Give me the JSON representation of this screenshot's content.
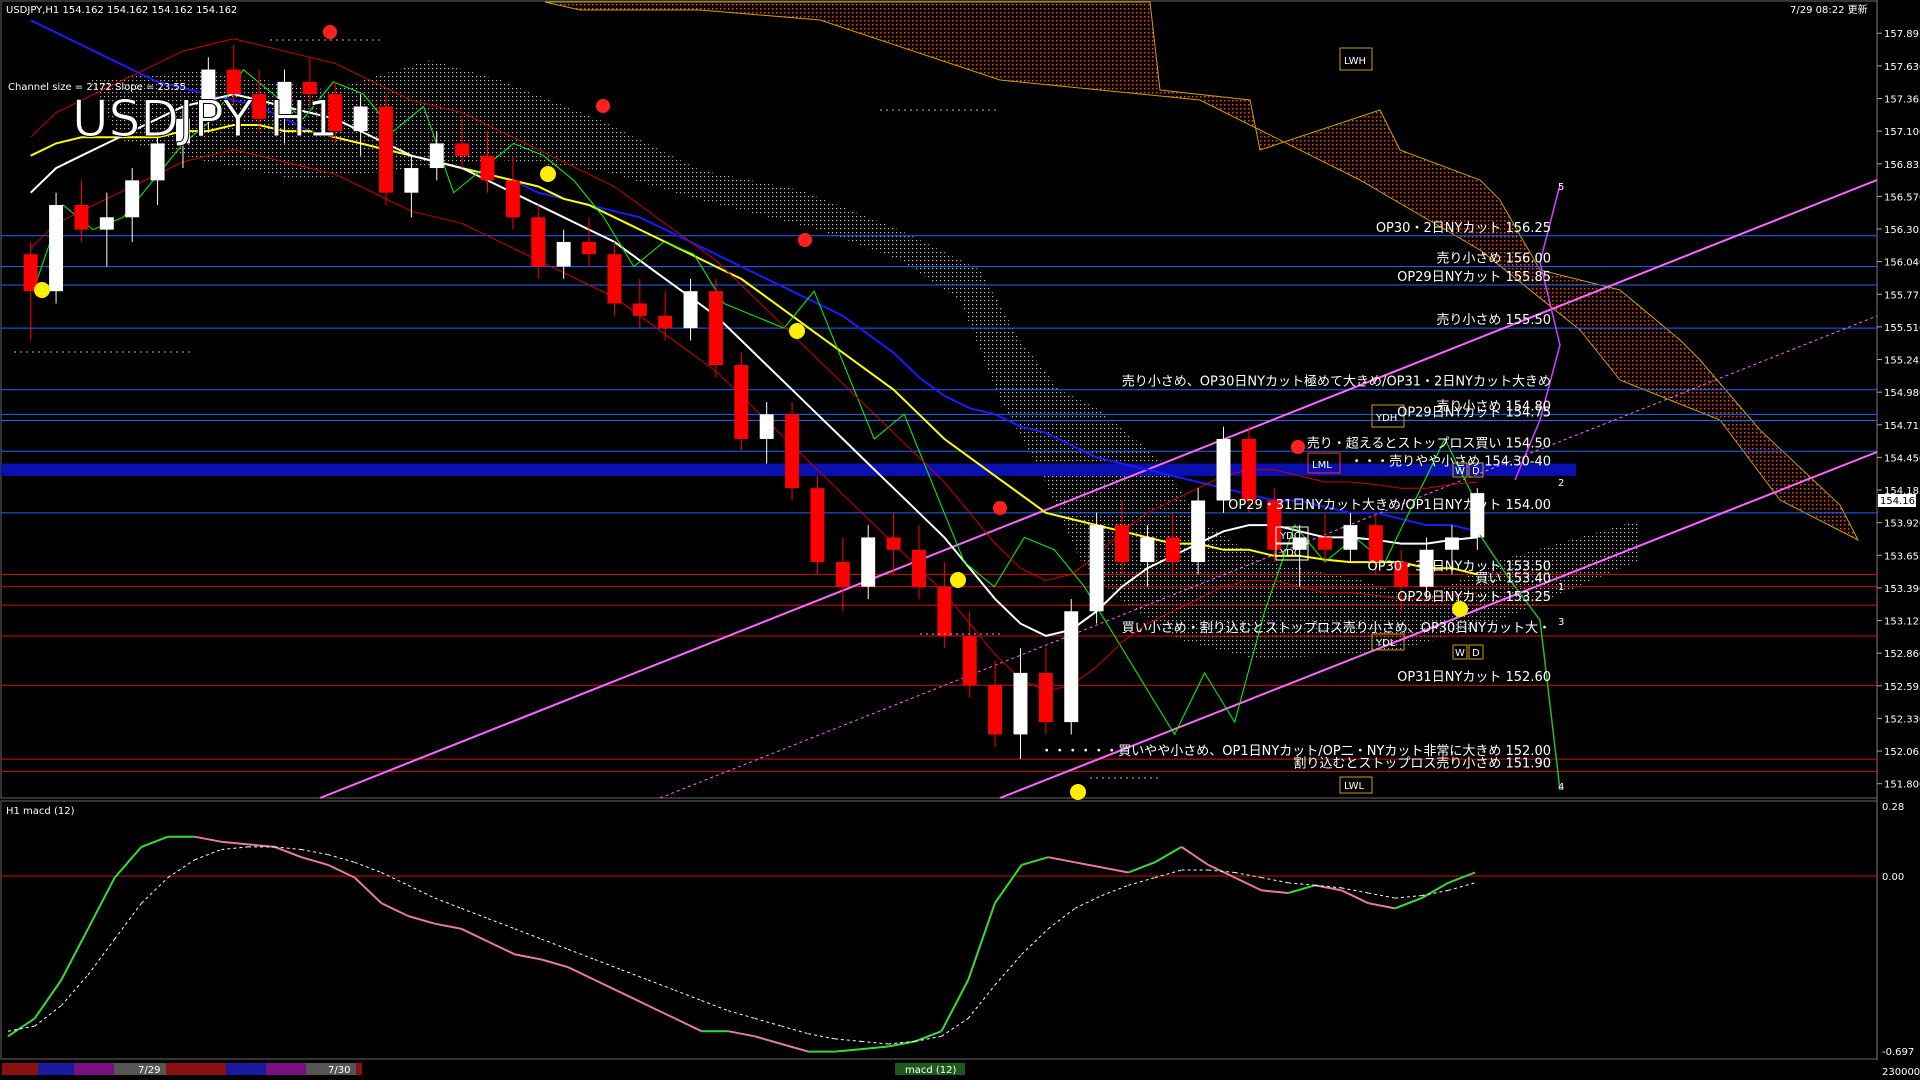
{
  "header": {
    "symbol_line": "USDJPY,H1   154.162 154.162 154.162 154.162",
    "timestamp": "7/29 08:22 更新",
    "channel_info": "Channel size = 2172 Slope = 23.55",
    "big_title": "USDJPY H1"
  },
  "sub_panel": {
    "title": "H1  macd (12)",
    "axis_top": "0.28",
    "axis_zero": "0.00",
    "axis_bottom": "-0.697",
    "axis_volume": "230000",
    "footer_dates": [
      "7/29",
      "7/30"
    ],
    "footer_label": "macd (12)"
  },
  "colors": {
    "background": "#000000",
    "bull_candle": "#ffffff",
    "bear_candle": "#ff0000",
    "ma_white": "#ffffff",
    "ma_yellow": "#ffff00",
    "ma_blue": "#1a1aff",
    "chikou": "#00ff00",
    "bollinger": "#cc0000",
    "kumo_bear": "#ff4010",
    "channel": "#ff66ff",
    "level_blue": "#1e64ff",
    "level_red": "#d01010",
    "band_blue": "#0a10b0"
  },
  "chart_data": {
    "type": "candlestick",
    "title": "USDJPY H1",
    "ylim": [
      151.7,
      158.1
    ],
    "yticks": [
      "157.895",
      "157.630",
      "157.365",
      "157.100",
      "156.835",
      "156.570",
      "156.305",
      "156.040",
      "155.775",
      "155.510",
      "155.245",
      "154.980",
      "154.715",
      "154.450",
      "154.185",
      "153.920",
      "153.655",
      "153.390",
      "153.125",
      "152.860",
      "152.595",
      "152.330",
      "152.065",
      "151.800"
    ],
    "current_price": "154.162",
    "candles_ohlc": [
      [
        156.1,
        156.2,
        155.4,
        155.8
      ],
      [
        155.8,
        156.6,
        155.7,
        156.5
      ],
      [
        156.5,
        156.7,
        156.2,
        156.3
      ],
      [
        156.3,
        156.6,
        156.0,
        156.4
      ],
      [
        156.4,
        156.8,
        156.2,
        156.7
      ],
      [
        156.7,
        157.1,
        156.5,
        157.0
      ],
      [
        157.0,
        157.3,
        156.8,
        157.2
      ],
      [
        157.2,
        157.7,
        157.1,
        157.6
      ],
      [
        157.6,
        157.8,
        157.3,
        157.4
      ],
      [
        157.4,
        157.6,
        157.1,
        157.2
      ],
      [
        157.2,
        157.6,
        157.0,
        157.5
      ],
      [
        157.5,
        157.7,
        157.3,
        157.4
      ],
      [
        157.4,
        157.5,
        157.0,
        157.1
      ],
      [
        157.1,
        157.4,
        156.9,
        157.3
      ],
      [
        157.3,
        157.4,
        156.5,
        156.6
      ],
      [
        156.6,
        156.9,
        156.4,
        156.8
      ],
      [
        156.8,
        157.1,
        156.7,
        157.0
      ],
      [
        157.0,
        157.2,
        156.8,
        156.9
      ],
      [
        156.9,
        157.1,
        156.6,
        156.7
      ],
      [
        156.7,
        156.9,
        156.3,
        156.4
      ],
      [
        156.4,
        156.5,
        155.9,
        156.0
      ],
      [
        156.0,
        156.3,
        155.9,
        156.2
      ],
      [
        156.2,
        156.4,
        156.0,
        156.1
      ],
      [
        156.1,
        156.2,
        155.6,
        155.7
      ],
      [
        155.7,
        155.9,
        155.5,
        155.6
      ],
      [
        155.6,
        155.8,
        155.4,
        155.5
      ],
      [
        155.5,
        155.9,
        155.4,
        155.8
      ],
      [
        155.8,
        155.9,
        155.1,
        155.2
      ],
      [
        155.2,
        155.3,
        154.5,
        154.6
      ],
      [
        154.6,
        154.9,
        154.4,
        154.8
      ],
      [
        154.8,
        154.9,
        154.1,
        154.2
      ],
      [
        154.2,
        154.3,
        153.5,
        153.6
      ],
      [
        153.6,
        153.8,
        153.2,
        153.4
      ],
      [
        153.4,
        153.9,
        153.3,
        153.8
      ],
      [
        153.8,
        154.0,
        153.5,
        153.7
      ],
      [
        153.7,
        153.9,
        153.3,
        153.4
      ],
      [
        153.4,
        153.6,
        152.9,
        153.0
      ],
      [
        153.0,
        153.2,
        152.5,
        152.6
      ],
      [
        152.6,
        152.8,
        152.1,
        152.2
      ],
      [
        152.2,
        152.9,
        152.0,
        152.7
      ],
      [
        152.7,
        152.9,
        152.2,
        152.3
      ],
      [
        152.3,
        153.3,
        152.2,
        153.2
      ],
      [
        153.2,
        154.0,
        153.1,
        153.9
      ],
      [
        153.9,
        154.1,
        153.5,
        153.6
      ],
      [
        153.6,
        153.9,
        153.4,
        153.8
      ],
      [
        153.8,
        154.0,
        153.5,
        153.6
      ],
      [
        153.6,
        154.2,
        153.5,
        154.1
      ],
      [
        154.1,
        154.7,
        154.0,
        154.6
      ],
      [
        154.6,
        154.7,
        154.0,
        154.1
      ],
      [
        154.1,
        154.2,
        153.6,
        153.7
      ],
      [
        153.7,
        153.9,
        153.4,
        153.8
      ],
      [
        153.8,
        154.0,
        153.6,
        153.7
      ],
      [
        153.7,
        154.0,
        153.6,
        153.9
      ],
      [
        153.9,
        154.0,
        153.5,
        153.6
      ],
      [
        153.6,
        153.7,
        153.2,
        153.4
      ],
      [
        153.4,
        153.8,
        153.3,
        153.7
      ],
      [
        153.7,
        153.9,
        153.5,
        153.8
      ],
      [
        153.8,
        154.2,
        153.7,
        154.16
      ]
    ],
    "ma_white": [
      156.6,
      156.8,
      156.9,
      157.0,
      157.1,
      157.2,
      157.3,
      157.35,
      157.4,
      157.35,
      157.3,
      157.25,
      157.2,
      157.1,
      157.0,
      156.9,
      156.85,
      156.8,
      156.7,
      156.6,
      156.5,
      156.4,
      156.3,
      156.2,
      156.05,
      155.9,
      155.75,
      155.6,
      155.4,
      155.2,
      155.0,
      154.8,
      154.6,
      154.4,
      154.2,
      154.0,
      153.8,
      153.55,
      153.3,
      153.1,
      153.0,
      153.05,
      153.2,
      153.4,
      153.55,
      153.65,
      153.75,
      153.85,
      153.9,
      153.9,
      153.85,
      153.8,
      153.8,
      153.78,
      153.75,
      153.75,
      153.78,
      153.8
    ],
    "ma_yellow": [
      156.9,
      157.0,
      157.05,
      157.05,
      157.05,
      157.05,
      157.1,
      157.1,
      157.15,
      157.15,
      157.1,
      157.1,
      157.05,
      157.0,
      156.95,
      156.9,
      156.85,
      156.8,
      156.75,
      156.7,
      156.65,
      156.55,
      156.5,
      156.4,
      156.3,
      156.2,
      156.1,
      156.0,
      155.9,
      155.75,
      155.6,
      155.45,
      155.3,
      155.15,
      155.0,
      154.8,
      154.6,
      154.45,
      154.3,
      154.15,
      154.0,
      153.95,
      153.9,
      153.85,
      153.8,
      153.75,
      153.75,
      153.7,
      153.7,
      153.65,
      153.65,
      153.62,
      153.6,
      153.6,
      153.6,
      153.55,
      153.55,
      153.5
    ],
    "ma_blue": [
      158.0,
      157.9,
      157.8,
      157.7,
      157.6,
      157.5,
      157.45,
      157.4,
      157.35,
      157.3,
      157.2,
      157.1,
      157.05,
      157.0,
      156.95,
      156.9,
      156.85,
      156.8,
      156.75,
      156.7,
      156.6,
      156.55,
      156.5,
      156.45,
      156.4,
      156.3,
      156.2,
      156.1,
      156.0,
      155.9,
      155.8,
      155.7,
      155.6,
      155.45,
      155.3,
      155.1,
      154.95,
      154.85,
      154.8,
      154.7,
      154.65,
      154.55,
      154.45,
      154.4,
      154.35,
      154.3,
      154.25,
      154.2,
      154.15,
      154.1,
      154.1,
      154.05,
      154.0,
      154.0,
      153.95,
      153.9,
      153.9,
      153.85
    ],
    "chikou": [
      155.8,
      156.5,
      156.3,
      156.4,
      156.7,
      157.0,
      157.2,
      157.6,
      157.4,
      157.2,
      157.5,
      157.4,
      157.1,
      157.3,
      156.6,
      156.8,
      157.0,
      156.9,
      156.7,
      156.4,
      156.0,
      156.2,
      156.1,
      155.7,
      155.6,
      155.5,
      155.8,
      155.2,
      154.6,
      154.8,
      154.2,
      153.6,
      153.4,
      153.8,
      153.7,
      153.4,
      153.0,
      152.6,
      152.2,
      152.7,
      152.3,
      153.2,
      153.9,
      153.6,
      153.8,
      153.6,
      154.1,
      154.6,
      154.1
    ],
    "macd": [
      -0.62,
      -0.55,
      -0.4,
      -0.2,
      0.0,
      0.12,
      0.16,
      0.16,
      0.14,
      0.13,
      0.12,
      0.08,
      0.05,
      0.0,
      -0.1,
      -0.15,
      -0.18,
      -0.2,
      -0.25,
      -0.3,
      -0.32,
      -0.35,
      -0.4,
      -0.45,
      -0.5,
      -0.55,
      -0.6,
      -0.6,
      -0.62,
      -0.65,
      -0.68,
      -0.68,
      -0.67,
      -0.66,
      -0.64,
      -0.6,
      -0.4,
      -0.1,
      0.05,
      0.08,
      0.06,
      0.04,
      0.02,
      0.06,
      0.12,
      0.05,
      0.0,
      -0.05,
      -0.06,
      -0.03,
      -0.05,
      -0.1,
      -0.12,
      -0.08,
      -0.02,
      0.02
    ],
    "macd_signal": [
      -0.6,
      -0.58,
      -0.5,
      -0.38,
      -0.24,
      -0.1,
      0.0,
      0.07,
      0.11,
      0.12,
      0.12,
      0.11,
      0.09,
      0.06,
      0.02,
      -0.03,
      -0.08,
      -0.12,
      -0.16,
      -0.2,
      -0.24,
      -0.28,
      -0.32,
      -0.36,
      -0.4,
      -0.44,
      -0.48,
      -0.52,
      -0.55,
      -0.58,
      -0.61,
      -0.63,
      -0.64,
      -0.65,
      -0.64,
      -0.62,
      -0.55,
      -0.42,
      -0.3,
      -0.2,
      -0.12,
      -0.07,
      -0.03,
      0.0,
      0.03,
      0.03,
      0.02,
      0.0,
      -0.02,
      -0.03,
      -0.04,
      -0.06,
      -0.08,
      -0.07,
      -0.05,
      -0.02
    ]
  },
  "levels": [
    {
      "price": 156.25,
      "text": "OP30・2日NYカット 156.25",
      "color": "blue"
    },
    {
      "price": 156.0,
      "text": "売り小さめ 156.00",
      "color": "blue"
    },
    {
      "price": 155.85,
      "text": "OP29日NYカット 155.85",
      "color": "blue"
    },
    {
      "price": 155.5,
      "text": "売り小さめ 155.50",
      "color": "blue"
    },
    {
      "price": 155.0,
      "text": "売り小さめ、OP30日NYカット極めて大きめ/OP31・2日NYカット大きめ",
      "color": "blue"
    },
    {
      "price": 154.8,
      "text": "売り小さめ 154.80",
      "color": "blue"
    },
    {
      "price": 154.75,
      "text": "OP29日NYカット 154.75",
      "color": "blue"
    },
    {
      "price": 154.5,
      "text": "売り・超えるとストップロス買い 154.50",
      "color": "blue"
    },
    {
      "price": 154.35,
      "text": "・・・売りやや小さめ 154.30-40",
      "color": "band"
    },
    {
      "price": 154.0,
      "text": "OP29・31日NYカット大きめ/OP1日NYカット 154.00",
      "color": "blue"
    },
    {
      "price": 153.5,
      "text": "OP30・31日NYカット 153.50",
      "color": "red"
    },
    {
      "price": 153.4,
      "text": "買い 153.40",
      "color": "red"
    },
    {
      "price": 153.25,
      "text": "OP29日NYカット 153.25",
      "color": "red"
    },
    {
      "price": 153.0,
      "text": "買い小さめ・割り込むとストップロス売り小さめ、OP30日NYカット大・",
      "color": "red"
    },
    {
      "price": 152.6,
      "text": "OP31日NYカット 152.60",
      "color": "red"
    },
    {
      "price": 152.0,
      "text": "・・・・・・買いやや小さめ、OP1日NYカット/OP二・NYカット非常に大きめ 152.00",
      "color": "red"
    },
    {
      "price": 151.9,
      "text": "割り込むとストップロス売り小さめ 151.90",
      "color": "red"
    }
  ],
  "box_labels": [
    "LWH",
    "YDH",
    "LML",
    "YDC",
    "YDC",
    "YDL",
    "LWL",
    "W",
    "D",
    "W",
    "D"
  ],
  "wave_labels": [
    "5",
    "2",
    "1",
    "3",
    "4"
  ]
}
